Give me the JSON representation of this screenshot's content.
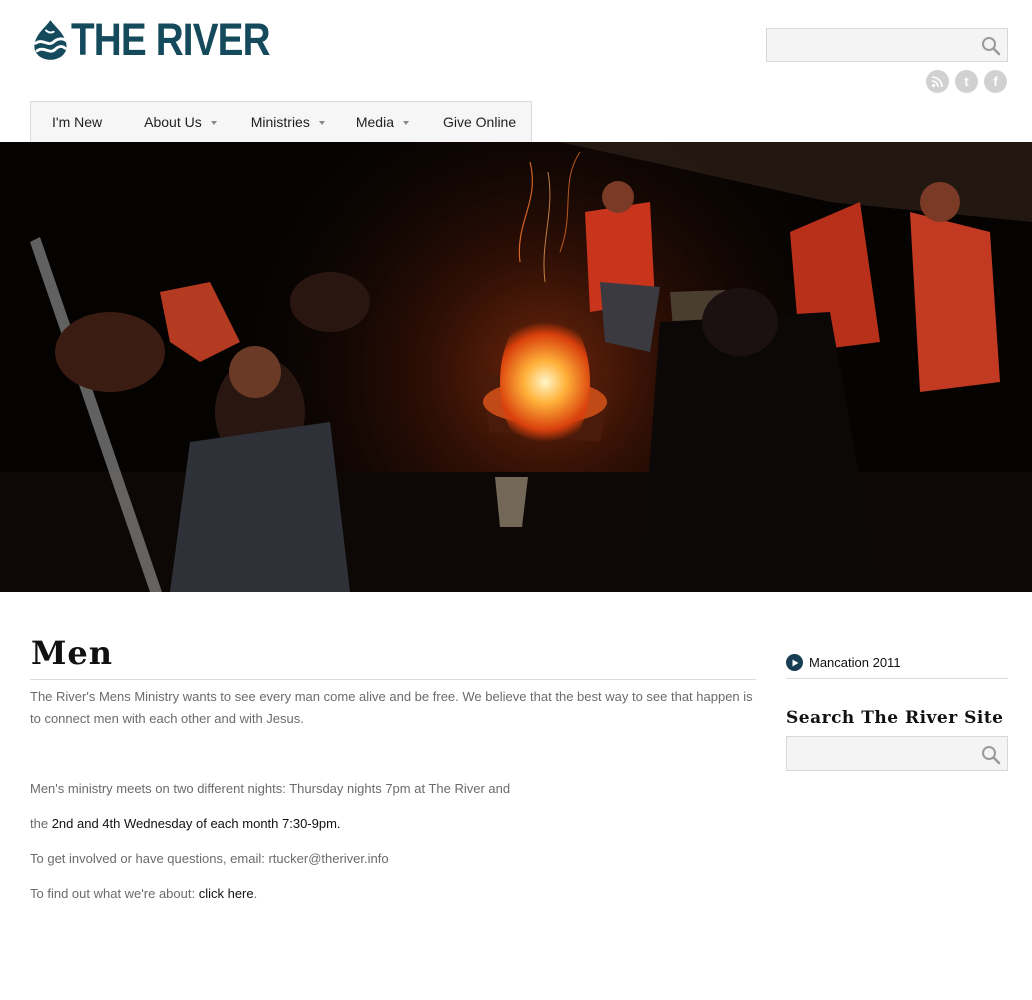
{
  "site": {
    "name": "THE RIVER"
  },
  "header": {
    "search": {
      "placeholder": ""
    },
    "social": [
      {
        "icon": "rss-icon",
        "glyph": ")"
      },
      {
        "icon": "twitter-icon",
        "glyph": "t"
      },
      {
        "icon": "facebook-icon",
        "glyph": "f"
      }
    ]
  },
  "nav": {
    "items": [
      {
        "label": "I'm New",
        "dropdown": false
      },
      {
        "label": "About Us",
        "dropdown": true
      },
      {
        "label": "Ministries",
        "dropdown": true
      },
      {
        "label": "Media",
        "dropdown": true
      },
      {
        "label": "Give Online",
        "dropdown": false
      }
    ]
  },
  "main": {
    "title": "Men",
    "intro": "The River's Mens Ministry wants to see every man come alive and be free. We believe that the best way to see that happen is to connect men with each other and with Jesus.",
    "meets_line1": "Men's ministry meets on two different nights:  Thursday nights 7pm at The River and",
    "meets_line2_prefix": "the ",
    "meets_line2_dark": "2nd and 4th Wednesday of each month 7:30-9pm",
    "meets_line2_suffix": ".",
    "contact": "To get involved or have questions, email: rtucker@theriver.info",
    "about_prefix": "To find out what we're about: ",
    "about_link": "click here",
    "about_suffix": "."
  },
  "sidebar": {
    "link_label": "Mancation 2011",
    "search_heading": "Search The River Site",
    "search": {
      "placeholder": ""
    }
  },
  "colors": {
    "brand": "#154a5c",
    "nav_bg": "#f6f6f6",
    "text": "#6b6b6b",
    "link": "#111111"
  }
}
